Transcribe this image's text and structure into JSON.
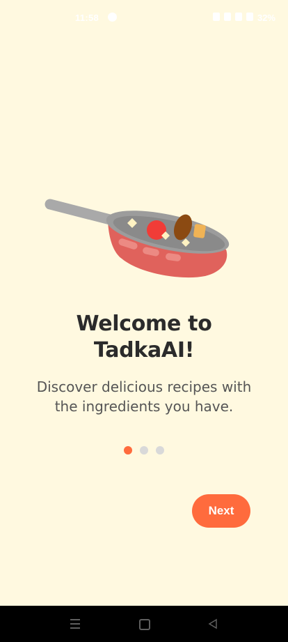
{
  "status_bar": {
    "time": "11:58",
    "battery": "32%"
  },
  "onboarding": {
    "title_line1": "Welcome to",
    "title_line2": "TadkaAI!",
    "subtitle_line1": "Discover delicious recipes with",
    "subtitle_line2": "the ingredients you have.",
    "page_indicator": {
      "current": 1,
      "total": 3
    },
    "next_label": "Next"
  },
  "colors": {
    "background": "#FFF9E0",
    "accent": "#FF6B3D",
    "dot_inactive": "#D9D9D9",
    "pan_red": "#E0625C",
    "text_dark": "#2B2B2B"
  },
  "icons": {
    "hero": "cooking-pan-icon",
    "nav_menu": "menu-icon",
    "nav_home": "home-icon",
    "nav_back": "back-icon"
  }
}
